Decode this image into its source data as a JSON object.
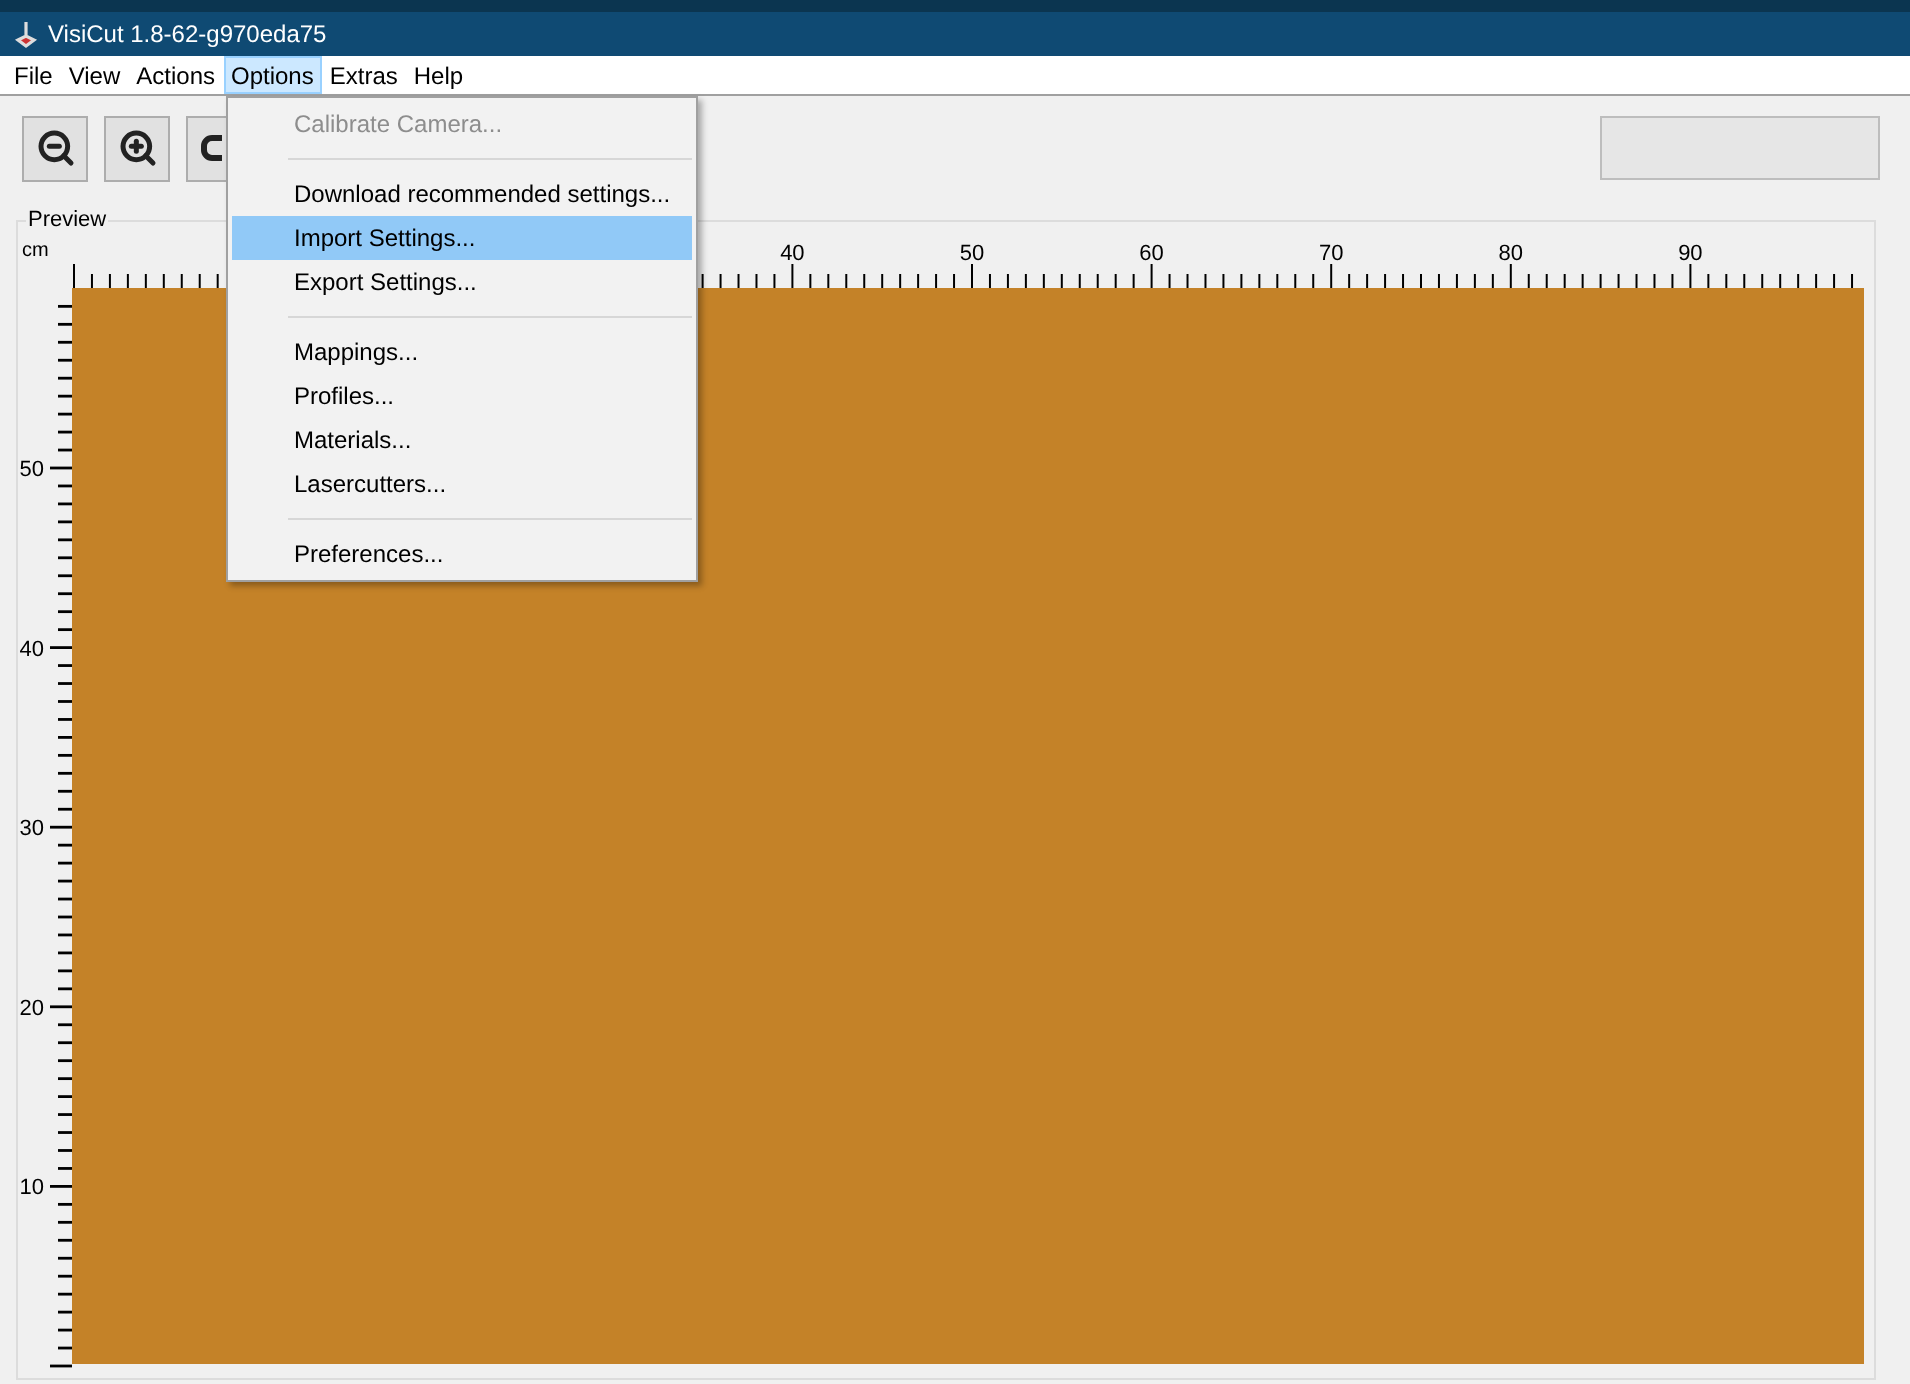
{
  "window": {
    "title": "VisiCut 1.8-62-g970eda75"
  },
  "menubar": [
    {
      "label": "File",
      "selected": false
    },
    {
      "label": "View",
      "selected": false
    },
    {
      "label": "Actions",
      "selected": false
    },
    {
      "label": "Options",
      "selected": true
    },
    {
      "label": "Extras",
      "selected": false
    },
    {
      "label": "Help",
      "selected": false
    }
  ],
  "options_menu": [
    {
      "kind": "item",
      "label": "Calibrate Camera...",
      "disabled": true,
      "selected": false
    },
    {
      "kind": "separator"
    },
    {
      "kind": "item",
      "label": "Download recommended settings...",
      "disabled": false,
      "selected": false
    },
    {
      "kind": "item",
      "label": "Import Settings...",
      "disabled": false,
      "selected": true
    },
    {
      "kind": "item",
      "label": "Export Settings...",
      "disabled": false,
      "selected": false
    },
    {
      "kind": "separator"
    },
    {
      "kind": "item",
      "label": "Mappings...",
      "disabled": false,
      "selected": false
    },
    {
      "kind": "item",
      "label": "Profiles...",
      "disabled": false,
      "selected": false
    },
    {
      "kind": "item",
      "label": "Materials...",
      "disabled": false,
      "selected": false
    },
    {
      "kind": "item",
      "label": "Lasercutters...",
      "disabled": false,
      "selected": false
    },
    {
      "kind": "separator"
    },
    {
      "kind": "item",
      "label": "Preferences...",
      "disabled": false,
      "selected": false
    }
  ],
  "toolbar": [
    {
      "kind": "zoom-out"
    },
    {
      "kind": "zoom-in"
    },
    {
      "kind": "zoom-fit"
    }
  ],
  "preview": {
    "title": "Preview",
    "unit": "cm",
    "x_labels": [
      "40",
      "50",
      "60",
      "70",
      "80",
      "90"
    ],
    "y_labels": [
      "50",
      "40",
      "30",
      "20",
      "10"
    ]
  }
}
